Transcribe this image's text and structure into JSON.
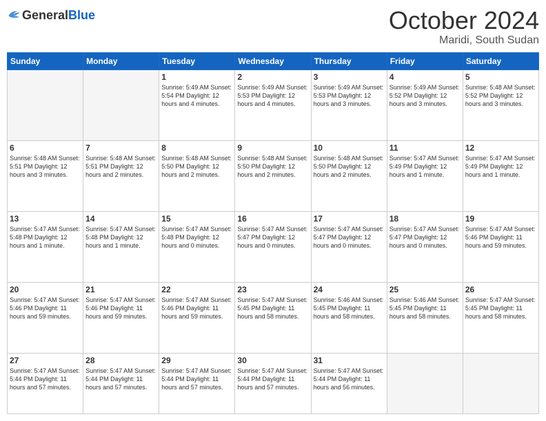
{
  "header": {
    "logo_general": "General",
    "logo_blue": "Blue",
    "month": "October 2024",
    "location": "Maridi, South Sudan"
  },
  "days_of_week": [
    "Sunday",
    "Monday",
    "Tuesday",
    "Wednesday",
    "Thursday",
    "Friday",
    "Saturday"
  ],
  "weeks": [
    [
      {
        "day": "",
        "content": ""
      },
      {
        "day": "",
        "content": ""
      },
      {
        "day": "1",
        "content": "Sunrise: 5:49 AM\nSunset: 5:54 PM\nDaylight: 12 hours and 4 minutes."
      },
      {
        "day": "2",
        "content": "Sunrise: 5:49 AM\nSunset: 5:53 PM\nDaylight: 12 hours and 4 minutes."
      },
      {
        "day": "3",
        "content": "Sunrise: 5:49 AM\nSunset: 5:53 PM\nDaylight: 12 hours and 3 minutes."
      },
      {
        "day": "4",
        "content": "Sunrise: 5:49 AM\nSunset: 5:52 PM\nDaylight: 12 hours and 3 minutes."
      },
      {
        "day": "5",
        "content": "Sunrise: 5:48 AM\nSunset: 5:52 PM\nDaylight: 12 hours and 3 minutes."
      }
    ],
    [
      {
        "day": "6",
        "content": "Sunrise: 5:48 AM\nSunset: 5:51 PM\nDaylight: 12 hours and 3 minutes."
      },
      {
        "day": "7",
        "content": "Sunrise: 5:48 AM\nSunset: 5:51 PM\nDaylight: 12 hours and 2 minutes."
      },
      {
        "day": "8",
        "content": "Sunrise: 5:48 AM\nSunset: 5:50 PM\nDaylight: 12 hours and 2 minutes."
      },
      {
        "day": "9",
        "content": "Sunrise: 5:48 AM\nSunset: 5:50 PM\nDaylight: 12 hours and 2 minutes."
      },
      {
        "day": "10",
        "content": "Sunrise: 5:48 AM\nSunset: 5:50 PM\nDaylight: 12 hours and 2 minutes."
      },
      {
        "day": "11",
        "content": "Sunrise: 5:47 AM\nSunset: 5:49 PM\nDaylight: 12 hours and 1 minute."
      },
      {
        "day": "12",
        "content": "Sunrise: 5:47 AM\nSunset: 5:49 PM\nDaylight: 12 hours and 1 minute."
      }
    ],
    [
      {
        "day": "13",
        "content": "Sunrise: 5:47 AM\nSunset: 5:48 PM\nDaylight: 12 hours and 1 minute."
      },
      {
        "day": "14",
        "content": "Sunrise: 5:47 AM\nSunset: 5:48 PM\nDaylight: 12 hours and 1 minute."
      },
      {
        "day": "15",
        "content": "Sunrise: 5:47 AM\nSunset: 5:48 PM\nDaylight: 12 hours and 0 minutes."
      },
      {
        "day": "16",
        "content": "Sunrise: 5:47 AM\nSunset: 5:47 PM\nDaylight: 12 hours and 0 minutes."
      },
      {
        "day": "17",
        "content": "Sunrise: 5:47 AM\nSunset: 5:47 PM\nDaylight: 12 hours and 0 minutes."
      },
      {
        "day": "18",
        "content": "Sunrise: 5:47 AM\nSunset: 5:47 PM\nDaylight: 12 hours and 0 minutes."
      },
      {
        "day": "19",
        "content": "Sunrise: 5:47 AM\nSunset: 5:46 PM\nDaylight: 11 hours and 59 minutes."
      }
    ],
    [
      {
        "day": "20",
        "content": "Sunrise: 5:47 AM\nSunset: 5:46 PM\nDaylight: 11 hours and 59 minutes."
      },
      {
        "day": "21",
        "content": "Sunrise: 5:47 AM\nSunset: 5:46 PM\nDaylight: 11 hours and 59 minutes."
      },
      {
        "day": "22",
        "content": "Sunrise: 5:47 AM\nSunset: 5:46 PM\nDaylight: 11 hours and 59 minutes."
      },
      {
        "day": "23",
        "content": "Sunrise: 5:47 AM\nSunset: 5:45 PM\nDaylight: 11 hours and 58 minutes."
      },
      {
        "day": "24",
        "content": "Sunrise: 5:46 AM\nSunset: 5:45 PM\nDaylight: 11 hours and 58 minutes."
      },
      {
        "day": "25",
        "content": "Sunrise: 5:46 AM\nSunset: 5:45 PM\nDaylight: 11 hours and 58 minutes."
      },
      {
        "day": "26",
        "content": "Sunrise: 5:47 AM\nSunset: 5:45 PM\nDaylight: 11 hours and 58 minutes."
      }
    ],
    [
      {
        "day": "27",
        "content": "Sunrise: 5:47 AM\nSunset: 5:44 PM\nDaylight: 11 hours and 57 minutes."
      },
      {
        "day": "28",
        "content": "Sunrise: 5:47 AM\nSunset: 5:44 PM\nDaylight: 11 hours and 57 minutes."
      },
      {
        "day": "29",
        "content": "Sunrise: 5:47 AM\nSunset: 5:44 PM\nDaylight: 11 hours and 57 minutes."
      },
      {
        "day": "30",
        "content": "Sunrise: 5:47 AM\nSunset: 5:44 PM\nDaylight: 11 hours and 57 minutes."
      },
      {
        "day": "31",
        "content": "Sunrise: 5:47 AM\nSunset: 5:44 PM\nDaylight: 11 hours and 56 minutes."
      },
      {
        "day": "",
        "content": ""
      },
      {
        "day": "",
        "content": ""
      }
    ]
  ]
}
